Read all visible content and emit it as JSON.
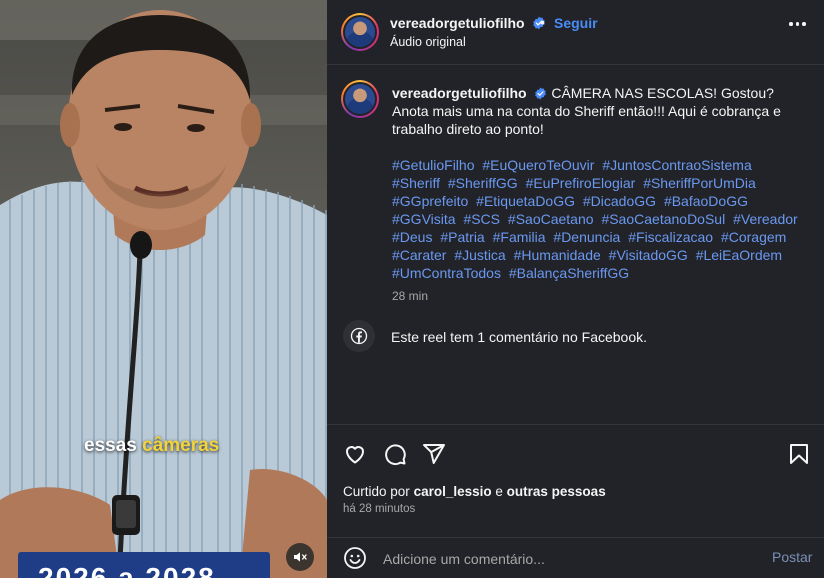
{
  "video": {
    "caption_text": "essas",
    "caption_highlight": "câmeras",
    "banner_text": "2026 a 2028",
    "mute_icon": "muted-speaker-icon"
  },
  "header": {
    "username": "vereadorgetuliofilho",
    "verified_icon": "verified-badge-icon",
    "dot": "•",
    "follow_label": "Seguir",
    "audio_label": "Áudio original",
    "more_icon": "more-options-icon"
  },
  "caption": {
    "username": "vereadorgetuliofilho",
    "text": "CÂMERA NAS ESCOLAS! Gostou? Anota mais uma na conta do Sheriff então!!! Aqui é cobrança e trabalho direto ao ponto!",
    "hashtags": [
      "#GetulioFilho",
      "#EuQueroTeOuvir",
      "#JuntosContraoSistema",
      "#Sheriff",
      "#SheriffGG",
      "#EuPrefiroElogiar",
      "#SheriffPorUmDia",
      "#GGprefeito",
      "#EtiquetaDoGG",
      "#DicadoGG",
      "#BafaoDoGG",
      "#GGVisita",
      "#SCS",
      "#SaoCaetano",
      "#SaoCaetanoDoSul",
      "#Vereador",
      "#Deus",
      "#Patria",
      "#Familia",
      "#Denuncia",
      "#Fiscalizacao",
      "#Coragem",
      "#Carater",
      "#Justica",
      "#Humanidade",
      "#VisitadoGG",
      "#LeiEaOrdem",
      "#UmContraTodos",
      "#BalançaSheriffGG"
    ],
    "time": "28 min"
  },
  "facebook": {
    "icon": "facebook-icon",
    "text": "Este reel tem 1 comentário no Facebook."
  },
  "actions": {
    "like_icon": "heart-icon",
    "comment_icon": "comment-icon",
    "share_icon": "share-icon",
    "save_icon": "bookmark-icon"
  },
  "likes": {
    "prefix": "Curtido por",
    "user": "carol_lessio",
    "conjunction": "e",
    "others": "outras pessoas",
    "ago": "há 28 minutos"
  },
  "comment_box": {
    "emoji_icon": "emoji-icon",
    "placeholder": "Adicione um comentário...",
    "post_label": "Postar"
  },
  "colors": {
    "panel_bg": "#212328",
    "link_blue": "#4a8cf7",
    "hashtag_blue": "#6b98f0",
    "caption_highlight": "#f3d33a"
  }
}
